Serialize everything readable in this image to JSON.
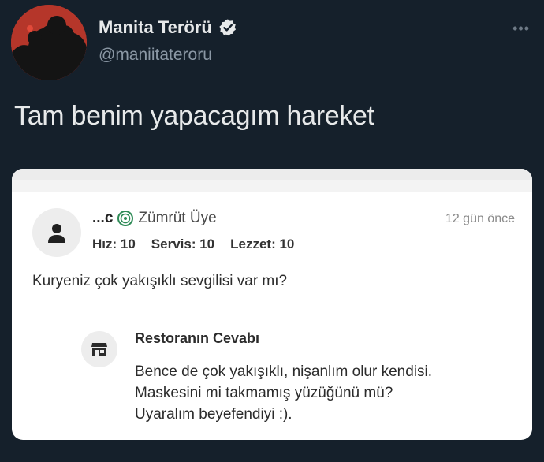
{
  "tweet": {
    "display_name": "Manita Terörü",
    "handle": "@maniitateroru",
    "more_icon": "more-dots-icon",
    "verified_icon": "verified-badge-icon",
    "text": "Tam benim yapacagım hareket"
  },
  "review": {
    "reviewer": "...c",
    "badge_icon": "emerald-member-icon",
    "badge": "Zümrüt Üye",
    "time": "12 gün önce",
    "ratings": [
      "Hız: 10",
      "Servis: 10",
      "Lezzet: 10"
    ],
    "comment": "Kuryeniz çok yakışıklı sevgilisi var mı?",
    "reply": {
      "icon": "store-icon",
      "title": "Restoranın Cevabı",
      "lines": [
        "Bence de çok yakışıklı, nişanlım olur kendisi.",
        "Maskesini mi takmamış yüzüğünü mü?",
        "Uyaralım beyefendiyi :)."
      ]
    }
  },
  "colors": {
    "background": "#15202b",
    "text_primary": "#e7e9ea",
    "text_secondary": "#8b98a5",
    "badge_green": "#2e8b57",
    "avatar_red": "#b5362a"
  }
}
